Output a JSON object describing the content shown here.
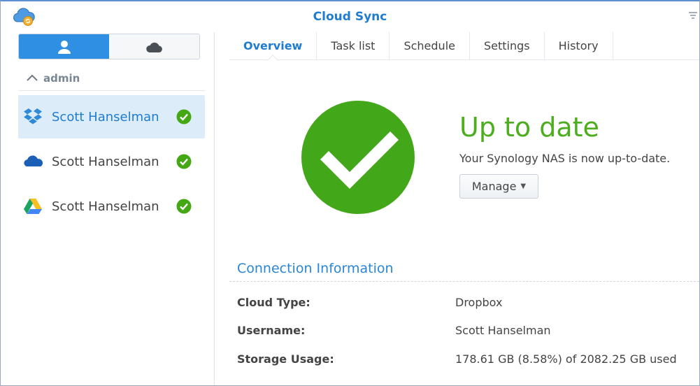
{
  "window": {
    "title": "Cloud Sync",
    "app_icon": "cloud-sync-app-icon",
    "filter_icon": "filter-icon"
  },
  "sidebar": {
    "segments": [
      {
        "icon": "user-icon",
        "active": true
      },
      {
        "icon": "cloud-icon",
        "active": false
      }
    ],
    "group": {
      "label": "admin",
      "expanded": true,
      "icon": "chevron-up-icon"
    },
    "accounts": [
      {
        "name": "Scott Hanselman",
        "service": "Dropbox",
        "service_icon": "dropbox-icon",
        "status_icon": "check-circle-icon",
        "selected": true
      },
      {
        "name": "Scott Hanselman",
        "service": "OneDrive",
        "service_icon": "onedrive-icon",
        "status_icon": "check-circle-icon",
        "selected": false
      },
      {
        "name": "Scott Hanselman",
        "service": "Google Drive",
        "service_icon": "google-drive-icon",
        "status_icon": "check-circle-icon",
        "selected": false
      }
    ]
  },
  "tabs": [
    {
      "label": "Overview",
      "active": true
    },
    {
      "label": "Task list",
      "active": false
    },
    {
      "label": "Schedule",
      "active": false
    },
    {
      "label": "Settings",
      "active": false
    },
    {
      "label": "History",
      "active": false
    }
  ],
  "status": {
    "title": "Up to date",
    "subtitle": "Your Synology NAS is now up-to-date.",
    "icon": "check-circle-large-icon",
    "manage_label": "Manage"
  },
  "connection": {
    "title": "Connection Information",
    "rows": [
      {
        "label": "Cloud Type:",
        "value": "Dropbox"
      },
      {
        "label": "Username:",
        "value": "Scott Hanselman"
      },
      {
        "label": "Storage Usage:",
        "value": "178.61 GB (8.58%) of 2082.25 GB used"
      }
    ]
  },
  "colors": {
    "accent": "#1f7cd1",
    "success": "#4cad1e",
    "selected_row": "#dcecf8",
    "segment_active": "#2e8fe3"
  }
}
